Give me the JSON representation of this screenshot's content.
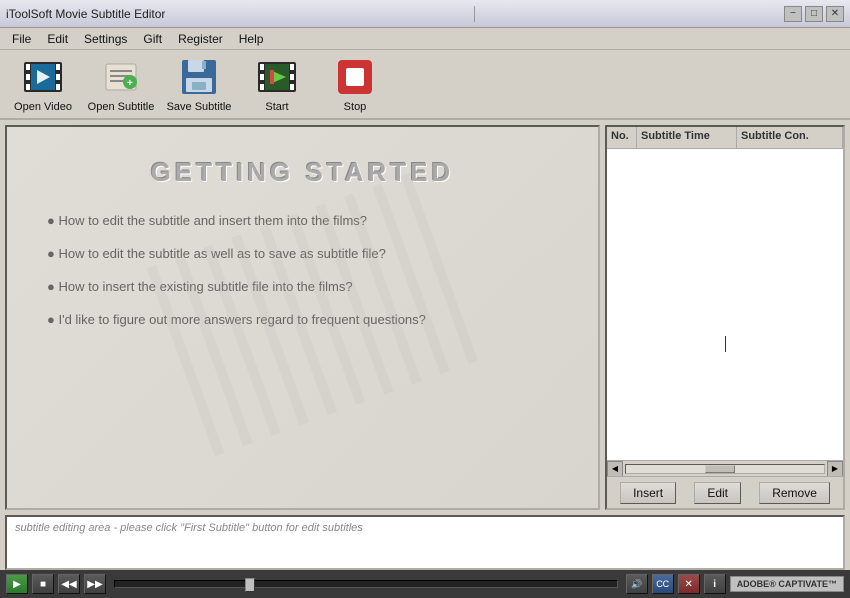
{
  "window": {
    "title": "iToolSoft Movie Subtitle Editor",
    "minimize_label": "−",
    "maximize_label": "□",
    "close_label": "✕"
  },
  "menu": {
    "items": [
      "File",
      "Edit",
      "Settings",
      "Gift",
      "Register",
      "Help"
    ]
  },
  "toolbar": {
    "buttons": [
      {
        "id": "open-video",
        "label": "Open Video"
      },
      {
        "id": "open-subtitle",
        "label": "Open Subtitle"
      },
      {
        "id": "save-subtitle",
        "label": "Save Subtitle"
      },
      {
        "id": "start",
        "label": "Start"
      },
      {
        "id": "stop",
        "label": "Stop"
      }
    ]
  },
  "preview": {
    "title": "GETTING  STARTED",
    "bullets": [
      "How to edit the subtitle and insert them into the films?",
      "How to edit the subtitle as well as to save as subtitle file?",
      "How to insert the existing subtitle file into the films?",
      "I'd like to figure out more answers regard to frequent questions?"
    ]
  },
  "subtitle_table": {
    "columns": [
      "No.",
      "Subtitle Time",
      "Subtitle Con."
    ],
    "rows": []
  },
  "subtitle_actions": {
    "insert_label": "Insert",
    "edit_label": "Edit",
    "remove_label": "Remove"
  },
  "subtitle_edit": {
    "placeholder": "subtitle editing area - please click \"First Subtitle\" button for edit subtitles"
  },
  "player": {
    "play_label": "▶",
    "stop_label": "■",
    "prev_label": "◀◀",
    "next_label": "▶▶",
    "volume_label": "🔊",
    "cc_label": "CC",
    "red_btn_label": "✕",
    "info_label": "i",
    "captivate_label": "ADOBE® CAPTIVATE™"
  }
}
